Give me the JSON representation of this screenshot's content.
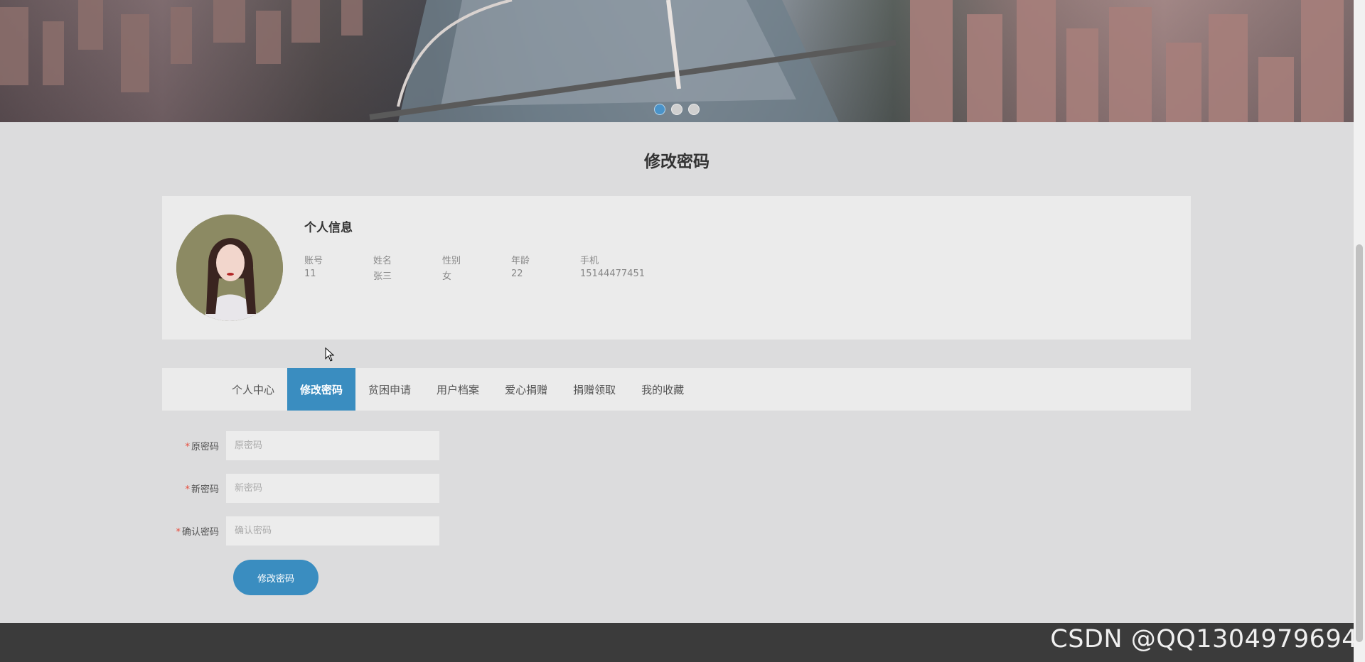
{
  "banner": {
    "dots": [
      {
        "state": "active"
      },
      {
        "state": "inactive"
      },
      {
        "state": "inactive"
      }
    ]
  },
  "page": {
    "title": "修改密码"
  },
  "profile": {
    "heading": "个人信息",
    "fields": [
      {
        "label": "账号",
        "value": "11"
      },
      {
        "label": "姓名",
        "value": "张三"
      },
      {
        "label": "性别",
        "value": "女"
      },
      {
        "label": "年龄",
        "value": "22"
      },
      {
        "label": "手机",
        "value": "15144477451"
      }
    ]
  },
  "tabs": [
    {
      "label": "个人中心",
      "active": false
    },
    {
      "label": "修改密码",
      "active": true
    },
    {
      "label": "贫困申请",
      "active": false
    },
    {
      "label": "用户档案",
      "active": false
    },
    {
      "label": "爱心捐赠",
      "active": false
    },
    {
      "label": "捐赠领取",
      "active": false
    },
    {
      "label": "我的收藏",
      "active": false
    }
  ],
  "form": {
    "required_mark": "*",
    "old_password": {
      "label": "原密码",
      "placeholder": "原密码",
      "value": ""
    },
    "new_password": {
      "label": "新密码",
      "placeholder": "新密码",
      "value": ""
    },
    "confirm_password": {
      "label": "确认密码",
      "placeholder": "确认密码",
      "value": ""
    },
    "submit_label": "修改密码"
  },
  "watermark": "CSDN @QQ1304979694",
  "colors": {
    "accent": "#3a8dc0",
    "footer": "#3b3b3b",
    "required": "#e74c3c"
  }
}
